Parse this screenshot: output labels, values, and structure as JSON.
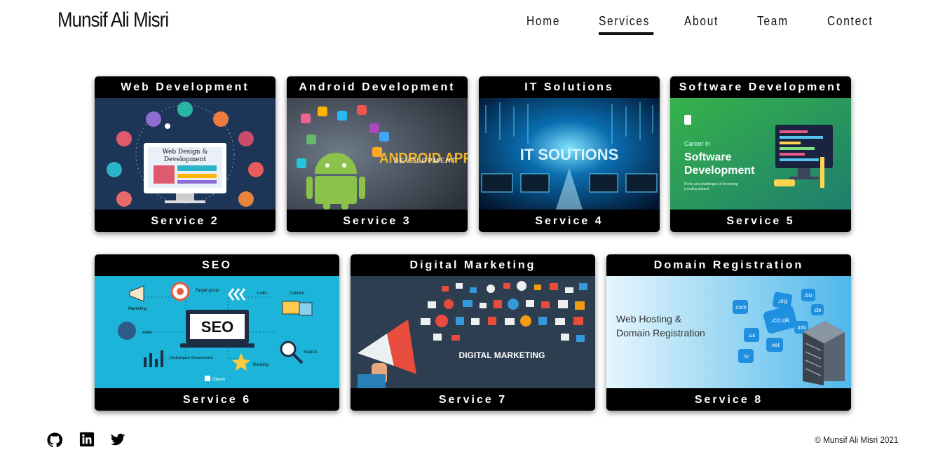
{
  "brand": "Munsif Ali Misri",
  "nav": [
    "Home",
    "Services",
    "About",
    "Team",
    "Contect"
  ],
  "active_nav": "Services",
  "services_row1": [
    {
      "title": "Web Development",
      "footer": "Service 2",
      "image_text": [
        "Web Design &",
        "Development"
      ]
    },
    {
      "title": "Android Development",
      "footer": "Service 3",
      "image_text": [
        "ANDROID APP",
        "DEVELOPMENT"
      ]
    },
    {
      "title": "IT Solutions",
      "footer": "Service 4",
      "image_text": [
        "IT SOUTIONS"
      ]
    },
    {
      "title": "Software Development",
      "footer": "Service 5",
      "image_text": [
        "Career in",
        "Software",
        "Development",
        "Perks and challenges of becoming",
        "a coding wizard."
      ]
    }
  ],
  "services_row2": [
    {
      "title": "SEO",
      "footer": "Service 6",
      "image_text": [
        "SEO",
        "Marketing",
        "Target group",
        "Links",
        "Content",
        "www",
        "Search",
        "Performance Measurement",
        "Ranking",
        "Oberlo"
      ]
    },
    {
      "title": "Digital Marketing",
      "footer": "Service 7",
      "image_text": [
        "DIGITAL MARKETING"
      ]
    },
    {
      "title": "Domain Registration",
      "footer": "Service 8",
      "image_text": [
        "Web Hosting &",
        "Domain Registration",
        ".co.uk",
        ".org",
        ".com",
        ".net",
        ".tv",
        ".biz",
        ".info",
        ".us",
        ".de"
      ]
    }
  ],
  "social_icons": [
    "github-icon",
    "linkedin-icon",
    "twitter-icon"
  ],
  "copyright": "© Munsif Ali Misri 2021",
  "colors": {
    "card_bg": "#000000",
    "text": "#111111",
    "page_bg": "#ffffff"
  }
}
